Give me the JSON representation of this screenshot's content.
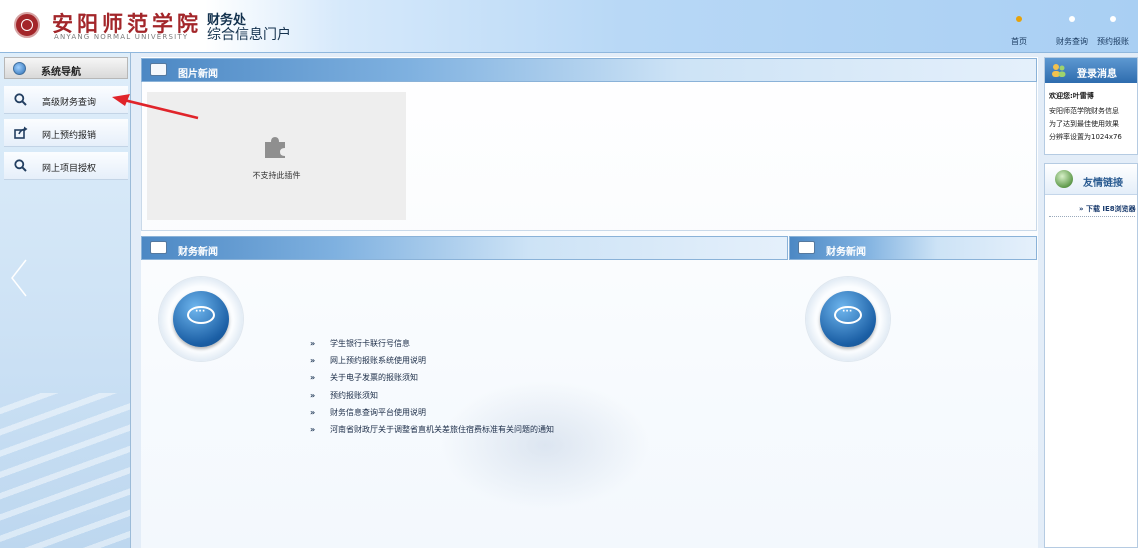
{
  "header": {
    "school_name": "安阳师范学院",
    "school_name_en": "ANYANG NORMAL UNIVERSITY",
    "dept_line1": "财务处",
    "dept_line2": "综合信息门户",
    "nav": [
      {
        "label": "首页",
        "icon": "home-dot-icon"
      },
      {
        "label": "财务查询",
        "icon": "dot-icon"
      },
      {
        "label": "预约报账",
        "icon": "dot-icon"
      }
    ]
  },
  "sidebar": {
    "header_label": "系统导航",
    "items": [
      {
        "label": "高级财务查询",
        "icon": "search-icon"
      },
      {
        "label": "网上预约报销",
        "icon": "share-icon"
      },
      {
        "label": "网上项目授权",
        "icon": "search-icon"
      }
    ]
  },
  "main": {
    "picture_news": {
      "title": "图片新闻",
      "plugin_text": "不支持此插件"
    },
    "finance_news_left": {
      "title": "财务新闻"
    },
    "finance_news_right": {
      "title": "财务新闻"
    },
    "news_items": [
      "学生银行卡联行号信息",
      "网上预约报账系统使用说明",
      "关于电子发票的报账须知",
      "预约报账须知",
      "财务信息查询平台使用说明",
      "河南省财政厅关于调整省直机关差旅住宿费标准有关问题的通知"
    ],
    "news_marker": "»"
  },
  "right": {
    "login": {
      "title": "登录消息",
      "lines": [
        "欢迎您:叶雷博",
        "安阳师范学院财务信息",
        "为了达到最佳使用效果",
        "分辨率设置为1024x76"
      ]
    },
    "links": {
      "title": "友情链接",
      "items": [
        "»  下载 IE8浏览器"
      ]
    }
  },
  "colors": {
    "brand_red": "#a3262a",
    "bar_blue": "#4c88c4",
    "annotation_red": "#e0242a"
  }
}
